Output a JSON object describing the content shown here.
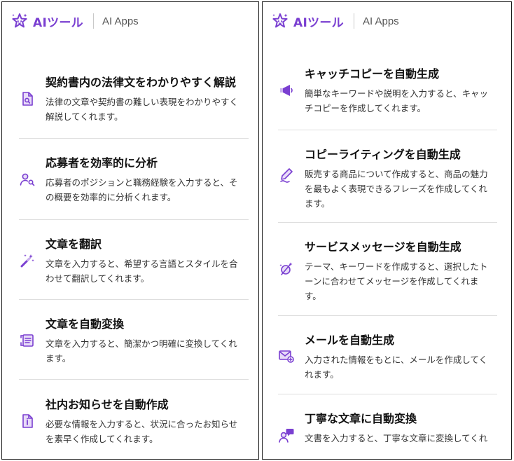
{
  "brand": {
    "name": "AIツール",
    "subtitle": "AI Apps"
  },
  "accent_color": "#7a3fd1",
  "left_panel": {
    "items": [
      {
        "title": "契約書内の法律文をわかりやすく解説",
        "description": "法律の文章や契約書の難しい表現をわかりやすく解説してくれます。",
        "icon": "document-search-icon"
      },
      {
        "title": "応募者を効率的に分析",
        "description": "応募者のポジションと職務経験を入力すると、その概要を効率的に分析くれます。",
        "icon": "user-search-icon"
      },
      {
        "title": "文章を翻訳",
        "description": "文章を入力すると、希望する言語とスタイルを合わせて翻訳してくれます。",
        "icon": "magic-wand-icon"
      },
      {
        "title": "文章を自動変換",
        "description": "文章を入力すると、簡潔かつ明確に変換してくれます。",
        "icon": "convert-text-icon"
      },
      {
        "title": "社内お知らせを自動作成",
        "description": "必要な情報を入力すると、状況に合ったお知らせを素早く作成してくれます。",
        "icon": "info-document-icon"
      }
    ]
  },
  "right_panel": {
    "items": [
      {
        "title": "キャッチコピーを自動生成",
        "description": "簡単なキーワードや説明を入力すると、キャッチコピーを作成してくれます。",
        "icon": "megaphone-icon"
      },
      {
        "title": "コピーライティングを自動生成",
        "description": "販売する商品について作成すると、商品の魅力を最もよく表現できるフレーズを作成してくれます。",
        "icon": "pen-icon"
      },
      {
        "title": "サービスメッセージを自動生成",
        "description": "テーマ、キーワードを作成すると、選択したトーンに合わせてメッセージを作成してくれます。",
        "icon": "sparkle-chat-icon"
      },
      {
        "title": "メールを自動生成",
        "description": "入力された情報をもとに、メールを作成してくれます。",
        "icon": "mail-add-icon"
      },
      {
        "title": "丁寧な文章に自動変換",
        "description": "文書を入力すると、丁寧な文章に変換してくれ",
        "icon": "person-chat-icon"
      }
    ]
  }
}
